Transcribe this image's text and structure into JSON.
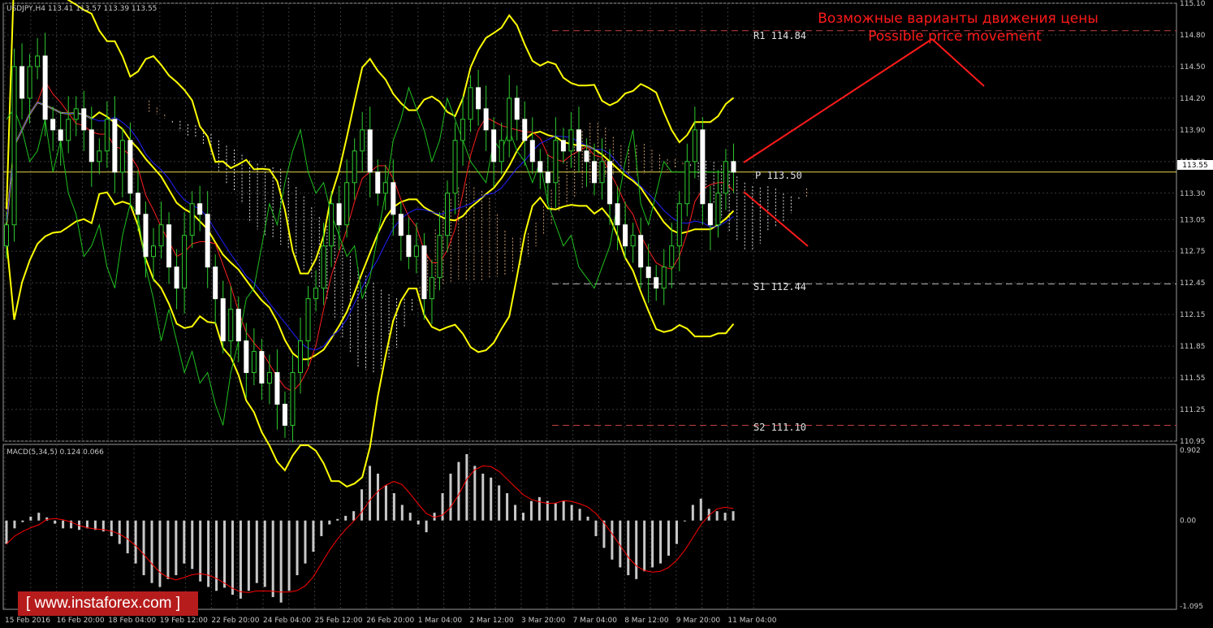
{
  "chart_data": [
    {
      "type": "candlestick",
      "title": "USDJPY,H4",
      "ohlc_header": "113.41 113.57 113.39 113.55",
      "price_axis": {
        "min": 110.95,
        "max": 115.1,
        "ticks": [
          "115.10",
          "114.80",
          "114.50",
          "114.20",
          "113.90",
          "113.60",
          "113.30",
          "113.05",
          "112.75",
          "112.45",
          "112.15",
          "111.85",
          "111.55",
          "111.25",
          "110.95"
        ],
        "current_price": "113.55"
      },
      "x_labels": [
        "15 Feb 2016",
        "16 Feb 20:00",
        "18 Feb 04:00",
        "19 Feb 12:00",
        "22 Feb 20:00",
        "24 Feb 04:00",
        "25 Feb 12:00",
        "26 Feb 20:00",
        "1 Mar 04:00",
        "2 Mar 12:00",
        "3 Mar 20:00",
        "7 Mar 04:00",
        "8 Mar 12:00",
        "9 Mar 20:00",
        "11 Mar 04:00"
      ],
      "levels": [
        {
          "label": "R1 114.84",
          "value": 114.84,
          "color": "#c04040",
          "style": "dashed"
        },
        {
          "label": "P 113.50",
          "value": 113.5,
          "color": "#e6d84a",
          "style": "solid"
        },
        {
          "label": "S1 112.44",
          "value": 112.44,
          "color": "#b0b0b0",
          "style": "dashed"
        },
        {
          "label": "S2 111.10",
          "value": 111.1,
          "color": "#c04040",
          "style": "dashed"
        }
      ],
      "annotation": {
        "line1": "Возможные варианты движения цены",
        "line2": "Possible price movement"
      },
      "closes": [
        113.0,
        114.5,
        114.2,
        114.5,
        114.6,
        114.0,
        113.9,
        113.8,
        114.0,
        114.1,
        113.9,
        113.6,
        113.7,
        114.0,
        113.5,
        113.8,
        113.3,
        113.1,
        112.7,
        112.8,
        113.0,
        112.6,
        112.4,
        112.9,
        113.2,
        113.1,
        112.6,
        112.3,
        111.9,
        112.2,
        111.9,
        111.6,
        111.8,
        111.5,
        111.6,
        111.3,
        111.1,
        111.6,
        111.9,
        112.3,
        112.4,
        112.8,
        113.2,
        113.0,
        113.4,
        113.7,
        113.9,
        113.5,
        113.3,
        113.4,
        113.1,
        112.9,
        112.7,
        112.8,
        112.3,
        112.5,
        112.9,
        113.3,
        113.8,
        114.0,
        114.3,
        114.1,
        113.9,
        113.6,
        113.8,
        114.2,
        114.0,
        113.8,
        113.6,
        113.5,
        113.4,
        113.8,
        113.7,
        113.9,
        113.7,
        113.6,
        113.4,
        113.6,
        113.2,
        113.0,
        112.8,
        112.9,
        112.6,
        112.5,
        112.4,
        112.6,
        112.8,
        113.2,
        113.6,
        113.9,
        113.2,
        113.0,
        113.3,
        113.6,
        113.5
      ],
      "series": [
        {
          "name": "Bollinger Bands",
          "color": "#ffff00"
        },
        {
          "name": "Ichimoku",
          "colors": [
            "#ff2020",
            "#2020ff",
            "#20c020"
          ]
        }
      ]
    },
    {
      "type": "histogram",
      "title": "MACD(5,34,5) 0.124 0.066",
      "ylim": [
        -1.095,
        0.902
      ],
      "ticks": [
        "0.902",
        "0.00",
        "-1.095"
      ],
      "values": [
        -0.3,
        -0.1,
        -0.02,
        0.05,
        0.1,
        0.04,
        -0.04,
        -0.1,
        -0.1,
        -0.12,
        -0.1,
        -0.12,
        -0.14,
        -0.2,
        -0.3,
        -0.42,
        -0.55,
        -0.7,
        -0.8,
        -0.85,
        -0.75,
        -0.7,
        -0.55,
        -0.62,
        -0.78,
        -0.85,
        -0.9,
        -0.86,
        -0.95,
        -1.0,
        -0.9,
        -0.8,
        -0.85,
        -0.98,
        -1.05,
        -0.9,
        -0.7,
        -0.55,
        -0.4,
        -0.2,
        -0.05,
        0.02,
        0.06,
        0.12,
        0.4,
        0.7,
        0.6,
        0.45,
        0.35,
        0.2,
        0.1,
        -0.05,
        -0.15,
        0.1,
        0.35,
        0.6,
        0.75,
        0.85,
        0.7,
        0.6,
        0.55,
        0.45,
        0.35,
        0.2,
        0.1,
        0.25,
        0.3,
        0.25,
        0.22,
        0.25,
        0.2,
        0.15,
        0.05,
        -0.2,
        -0.35,
        -0.5,
        -0.6,
        -0.7,
        -0.75,
        -0.65,
        -0.6,
        -0.55,
        -0.45,
        -0.3,
        0.0,
        0.2,
        0.28,
        0.15,
        0.12,
        0.1,
        0.12
      ],
      "signal_color": "#ff0000"
    }
  ],
  "watermark": "[ www.instaforex.com ]"
}
